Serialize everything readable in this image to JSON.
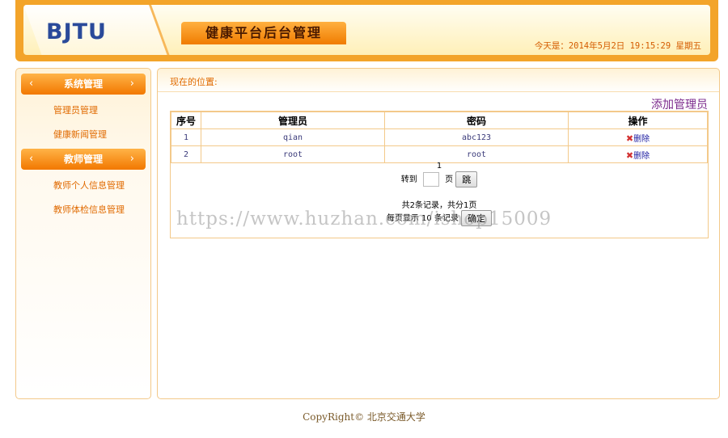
{
  "header": {
    "logo": "BJTU",
    "title": "健康平台后台管理",
    "date_text": "今天是：2014年5月2日 19:15:29 星期五"
  },
  "sidebar": {
    "sections": [
      {
        "label": "系统管理",
        "items": [
          "管理员管理",
          "健康新闻管理"
        ]
      },
      {
        "label": "教师管理",
        "items": [
          "教师个人信息管理",
          "教师体检信息管理"
        ]
      }
    ],
    "arrow_left": "‹",
    "arrow_right": "›"
  },
  "main": {
    "location_label": "现在的位置:",
    "add_link": "添加管理员",
    "table": {
      "headers": [
        "序号",
        "管理员",
        "密码",
        "操作"
      ],
      "rows": [
        {
          "index": "1",
          "admin": "qian",
          "password": "abc123",
          "action": "删除"
        },
        {
          "index": "2",
          "admin": "root",
          "password": "root",
          "action": "删除"
        }
      ]
    },
    "pager": {
      "current_page": "1",
      "goto_label": "转到",
      "page_label": "页",
      "jump_button": "跳",
      "summary": "共2条记录，共分1页",
      "per_page_label": "每页显示",
      "per_page_value": "10",
      "per_page_unit": "条记录",
      "confirm_button": "确定"
    }
  },
  "watermark": "https://www.huzhan.com/ishop15009",
  "footer": "CopyRight© 北京交通大学",
  "colors": {
    "accent": "#f3a42a",
    "link": "#e06a00",
    "title": "#7b2a8c"
  }
}
